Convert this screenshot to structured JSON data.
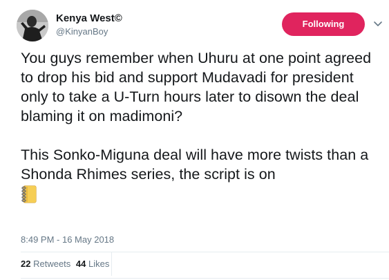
{
  "author": {
    "display_name": "Kenya West©",
    "handle": "@KinyanBoy",
    "avatar_icon": "profile-photo"
  },
  "follow_button": {
    "label": "Following",
    "color": "#e0245e"
  },
  "menu": {
    "icon": "chevron-down-icon"
  },
  "tweet": {
    "paragraph_1": "You guys remember when Uhuru at one point agreed to drop his bid and support Mudavadi for president only to take a U-Turn hours later to disown the deal blaming it on madimoni?",
    "paragraph_2": "This Sonko-Miguna deal will have more twists than a Shonda Rhimes series, the script is on",
    "emoji": "notebook-emoji"
  },
  "timestamp": "8:49 PM - 16 May 2018",
  "stats": {
    "retweets_count": "22",
    "retweets_label": "Retweets",
    "likes_count": "44",
    "likes_label": "Likes"
  },
  "colors": {
    "text": "#14171a",
    "muted": "#657786",
    "divider": "#e6ecf0"
  }
}
